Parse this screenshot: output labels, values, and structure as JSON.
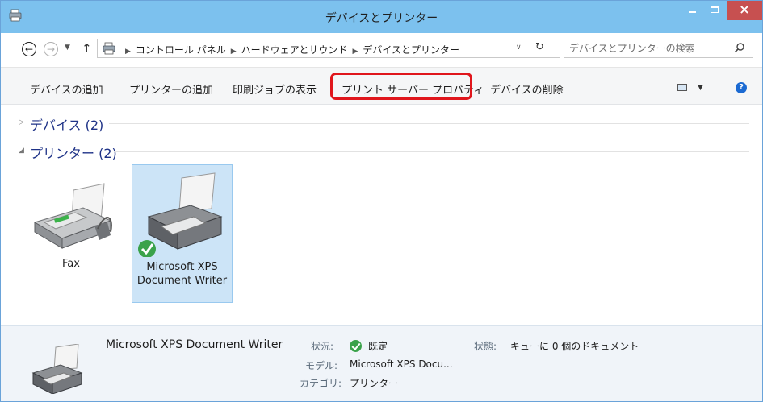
{
  "window": {
    "title": "デバイスとプリンター",
    "close_glyph": "×"
  },
  "address": {
    "breadcrumbs": [
      "コントロール パネル",
      "ハードウェアとサウンド",
      "デバイスとプリンター"
    ],
    "search_placeholder": "デバイスとプリンターの検索"
  },
  "toolbar": {
    "add_device": "デバイスの追加",
    "add_printer": "プリンターの追加",
    "print_jobs": "印刷ジョブの表示",
    "server_props": "プリント サーバー プロパティ",
    "remove_device": "デバイスの削除",
    "help_glyph": "?"
  },
  "groups": [
    {
      "label": "デバイス (2)",
      "expanded": false
    },
    {
      "label": "プリンター (2)",
      "expanded": true
    }
  ],
  "printers": [
    {
      "name": "Fax",
      "default": false,
      "selected": false
    },
    {
      "name": "Microsoft XPS Document Writer",
      "default": true,
      "selected": true
    }
  ],
  "details": {
    "name": "Microsoft XPS Document Writer",
    "status_label": "状況:",
    "status_value": "既定",
    "model_label": "モデル:",
    "model_value": "Microsoft XPS Docu...",
    "category_label": "カテゴリ:",
    "category_value": "プリンター",
    "state_label": "状態:",
    "state_value": "キューに 0 個のドキュメント"
  },
  "colors": {
    "titlebar": "#7cc1ee",
    "close": "#c75050",
    "highlight": "#e0161c",
    "selection": "#cce4f7",
    "group_title": "#1e3287",
    "default_check": "#3aa24a"
  },
  "icons": [
    "devices-printers-icon",
    "back-icon",
    "forward-icon",
    "up-icon",
    "refresh-icon",
    "search-icon",
    "view-options-icon",
    "help-icon",
    "fax-icon",
    "printer-icon"
  ]
}
